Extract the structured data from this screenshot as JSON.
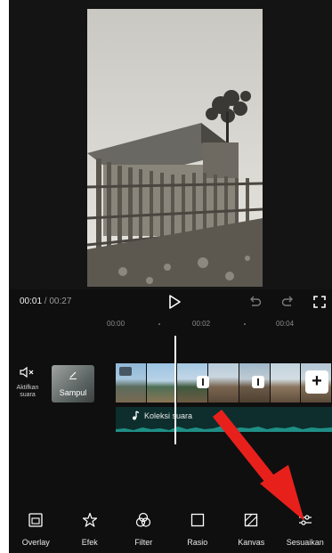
{
  "player": {
    "current_time": "00:01",
    "separator": " / ",
    "total_time": "00:27"
  },
  "ruler": {
    "marks": [
      "00:00",
      "00:02",
      "00:04"
    ]
  },
  "timeline": {
    "mute_label": "Aktifkan suara",
    "cover_label": "Sampul",
    "audio_label": "Koleksi suara",
    "add_label": "+"
  },
  "toolbar": {
    "items": [
      {
        "label": "Overlay",
        "icon": "overlay-icon"
      },
      {
        "label": "Efek",
        "icon": "effects-icon"
      },
      {
        "label": "Filter",
        "icon": "filter-icon"
      },
      {
        "label": "Rasio",
        "icon": "ratio-icon"
      },
      {
        "label": "Kanvas",
        "icon": "canvas-icon"
      },
      {
        "label": "Sesuaikan",
        "icon": "adjust-icon"
      }
    ]
  },
  "colors": {
    "background": "#0f0f0f",
    "audio_track": "#0d2e2c",
    "audio_wave": "#1f8f86",
    "annotation_arrow": "#e8201c"
  }
}
